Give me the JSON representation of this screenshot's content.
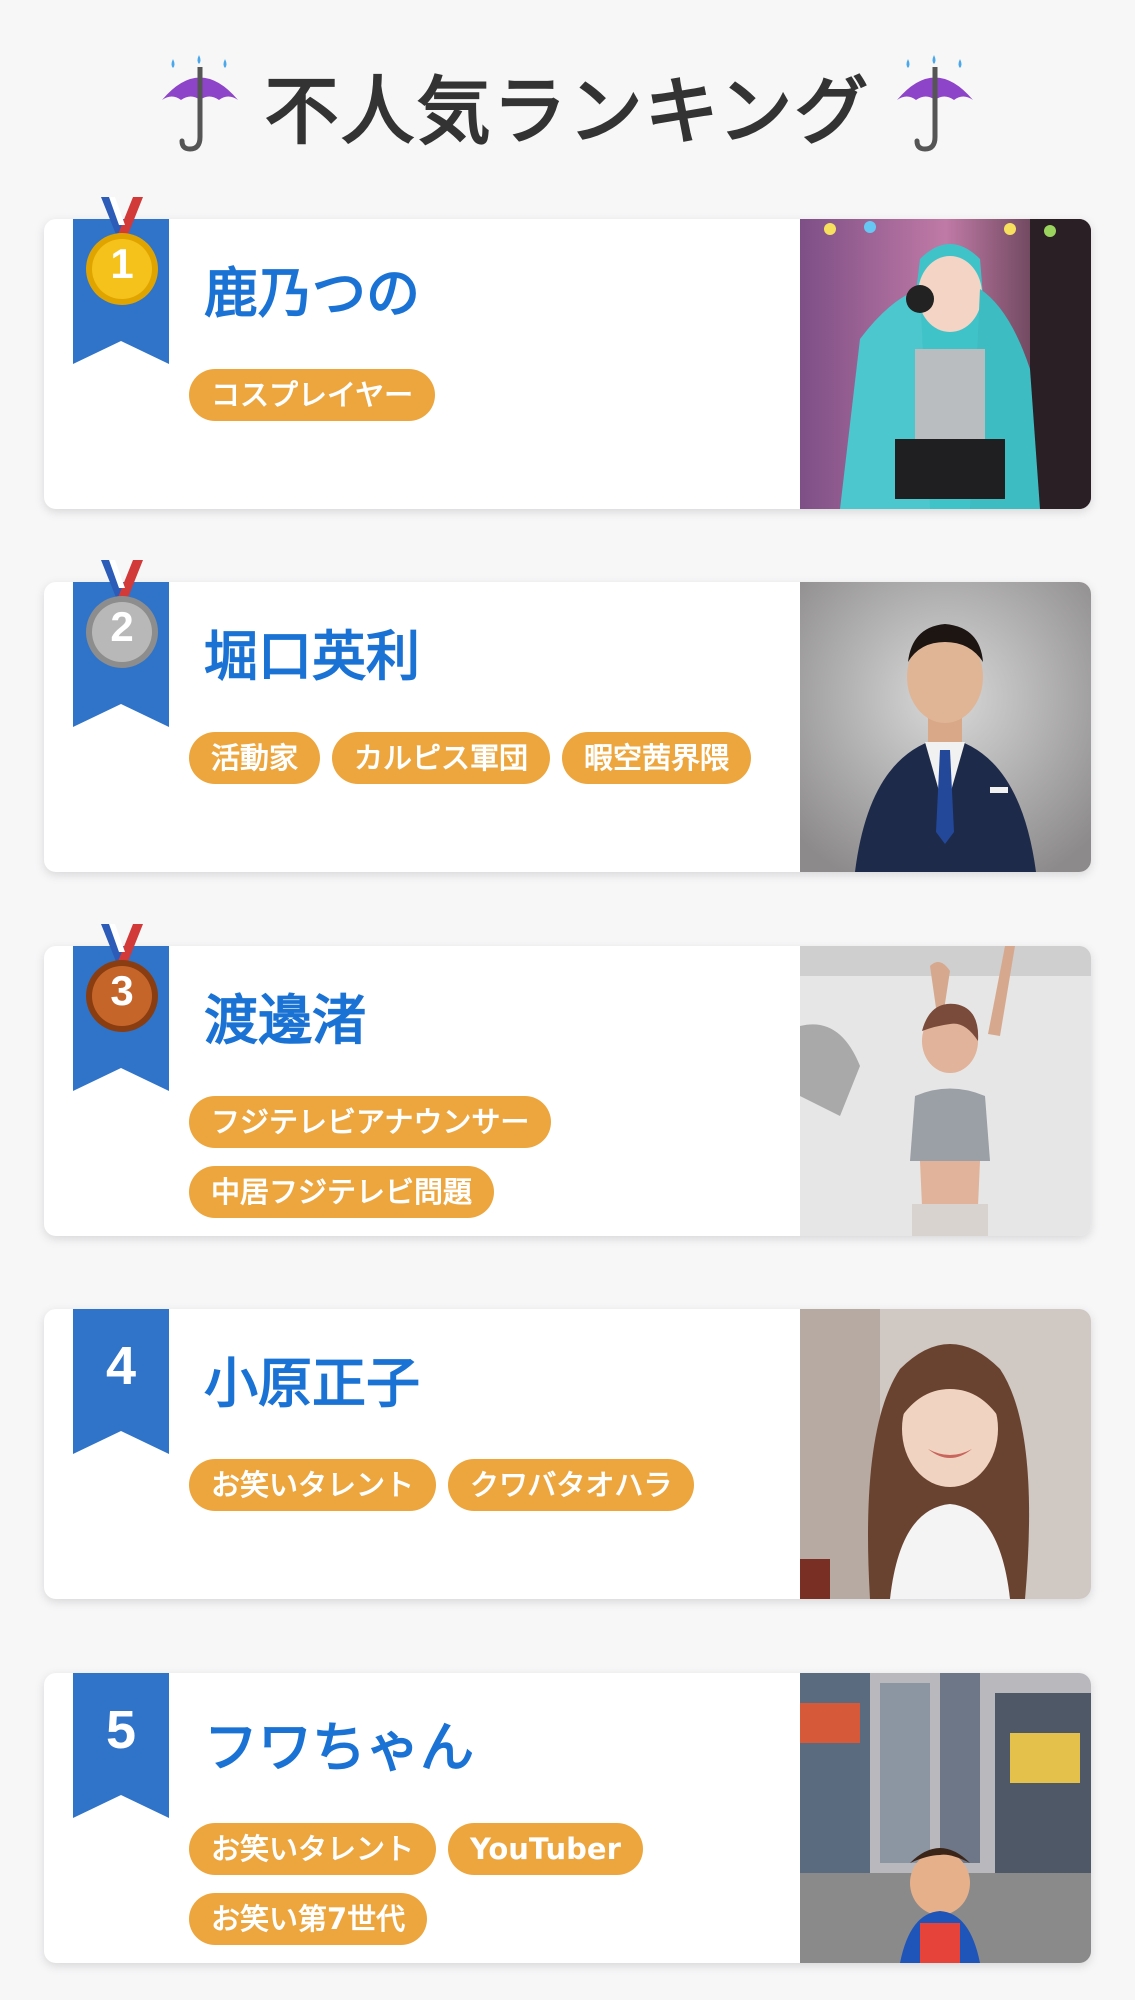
{
  "header": {
    "title": "不人気ランキング",
    "left_icon": "umbrella-rain-icon",
    "right_icon": "umbrella-rain-icon"
  },
  "colors": {
    "accent_blue": "#2f74c9",
    "name_blue": "#1a73d4",
    "tag_orange": "#eda63e",
    "gold": "#f0b800",
    "silver": "#a8a8a8",
    "bronze": "#b45a1c"
  },
  "ranking": [
    {
      "rank": "1",
      "badge": "gold-medal-icon",
      "name": "鹿乃つの",
      "tags": [
        "コスプレイヤー"
      ],
      "photo": "cosplayer-photo"
    },
    {
      "rank": "2",
      "badge": "silver-medal-icon",
      "name": "堀口英利",
      "tags": [
        "活動家",
        "カルピス軍団",
        "暇空茜界隈"
      ],
      "photo": "man-in-suit-photo"
    },
    {
      "rank": "3",
      "badge": "bronze-medal-icon",
      "name": "渡邊渚",
      "tags": [
        "フジテレビアナウンサー",
        "中居フジテレビ問題"
      ],
      "photo": "woman-posing-photo"
    },
    {
      "rank": "4",
      "badge": "ribbon-number",
      "name": "小原正子",
      "tags": [
        "お笑いタレント",
        "クワバタオハラ"
      ],
      "photo": "woman-smiling-photo"
    },
    {
      "rank": "5",
      "badge": "ribbon-number",
      "name": "フワちゃん",
      "tags": [
        "お笑いタレント",
        "YouTuber",
        "お笑い第7世代"
      ],
      "photo": "street-photo"
    }
  ]
}
